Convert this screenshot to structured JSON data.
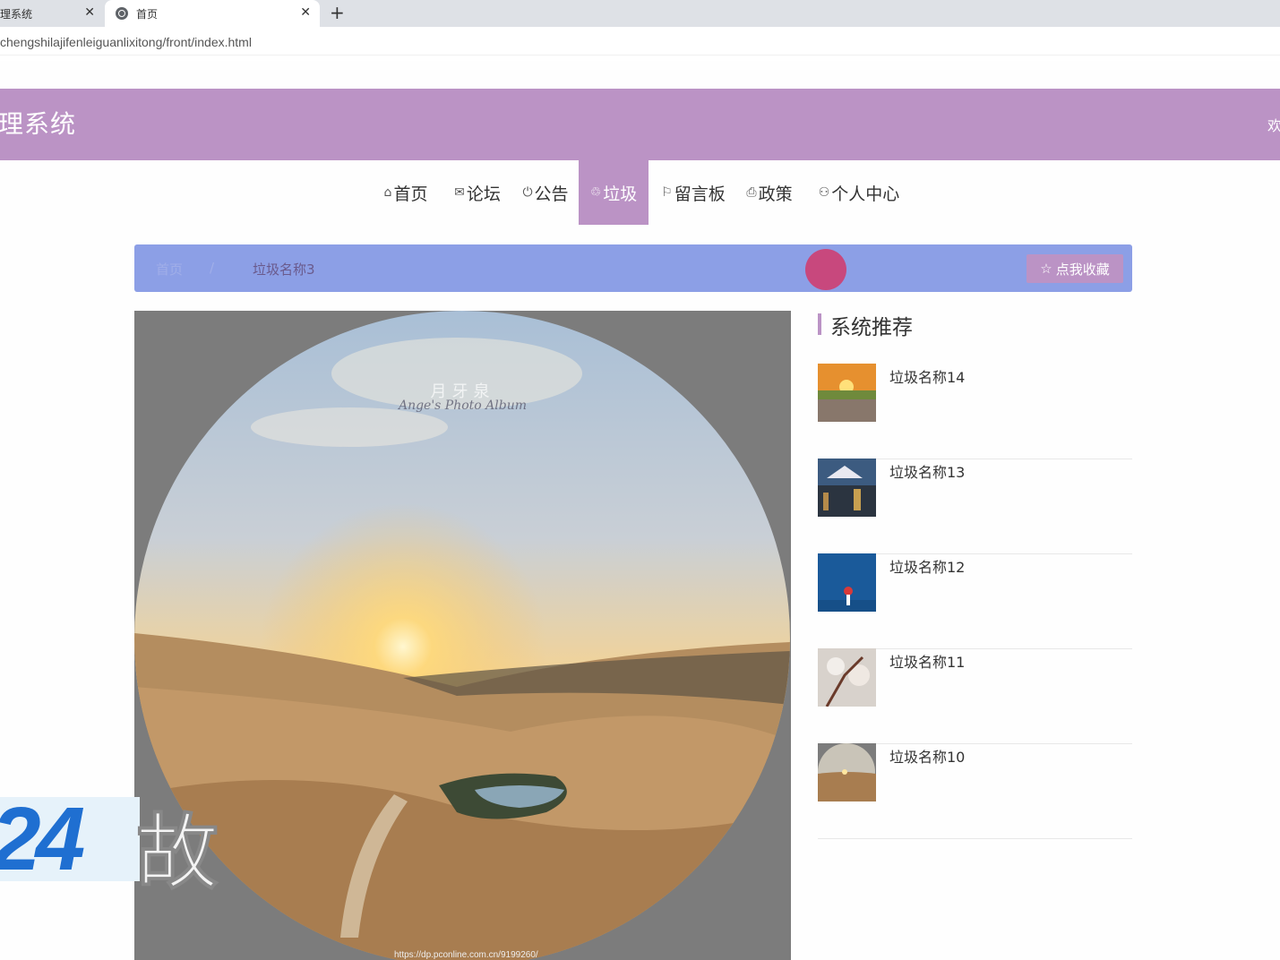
{
  "browser": {
    "tabs": [
      {
        "label": "理系统"
      },
      {
        "label": "首页"
      }
    ],
    "close_glyph": "✕",
    "new_tab_glyph": "+",
    "url": "chengshilajifenleiguanlixitong/front/index.html"
  },
  "header": {
    "title": "理系统",
    "right_text": "欢"
  },
  "nav": {
    "items": [
      {
        "label": "首页",
        "icon": "home-icon",
        "glyph": "⌂"
      },
      {
        "label": "论坛",
        "icon": "mail-icon",
        "glyph": "✉"
      },
      {
        "label": "公告",
        "icon": "power-icon",
        "glyph": "⏻"
      },
      {
        "label": "垃圾",
        "icon": "recycle-icon",
        "glyph": "♲",
        "active": true
      },
      {
        "label": "留言板",
        "icon": "flag-icon",
        "glyph": "⚐"
      },
      {
        "label": "政策",
        "icon": "print-icon",
        "glyph": "⎙"
      },
      {
        "label": "个人中心",
        "icon": "user-icon",
        "glyph": "⚇"
      }
    ],
    "active_color": "#bb93c5"
  },
  "breadcrumb": {
    "home": "首页",
    "separator": "/",
    "current": "垃圾名称3",
    "favorite_label": "点我收藏",
    "favorite_icon": "star-icon",
    "bar_color": "#8c9fe6"
  },
  "main_image": {
    "watermark_cn": "月牙泉",
    "watermark_en": "Ange's Photo Album",
    "source_url": "https://dp.pconline.com.cn/9199260/"
  },
  "overlay": {
    "logo_text": "24",
    "char": "故"
  },
  "sidebar": {
    "title": "系统推荐",
    "items": [
      {
        "name": "垃圾名称14"
      },
      {
        "name": "垃圾名称13"
      },
      {
        "name": "垃圾名称12"
      },
      {
        "name": "垃圾名称11"
      },
      {
        "name": "垃圾名称10"
      }
    ]
  },
  "theme": {
    "primary": "#bb93c5",
    "breadcrumb": "#8c9fe6"
  }
}
